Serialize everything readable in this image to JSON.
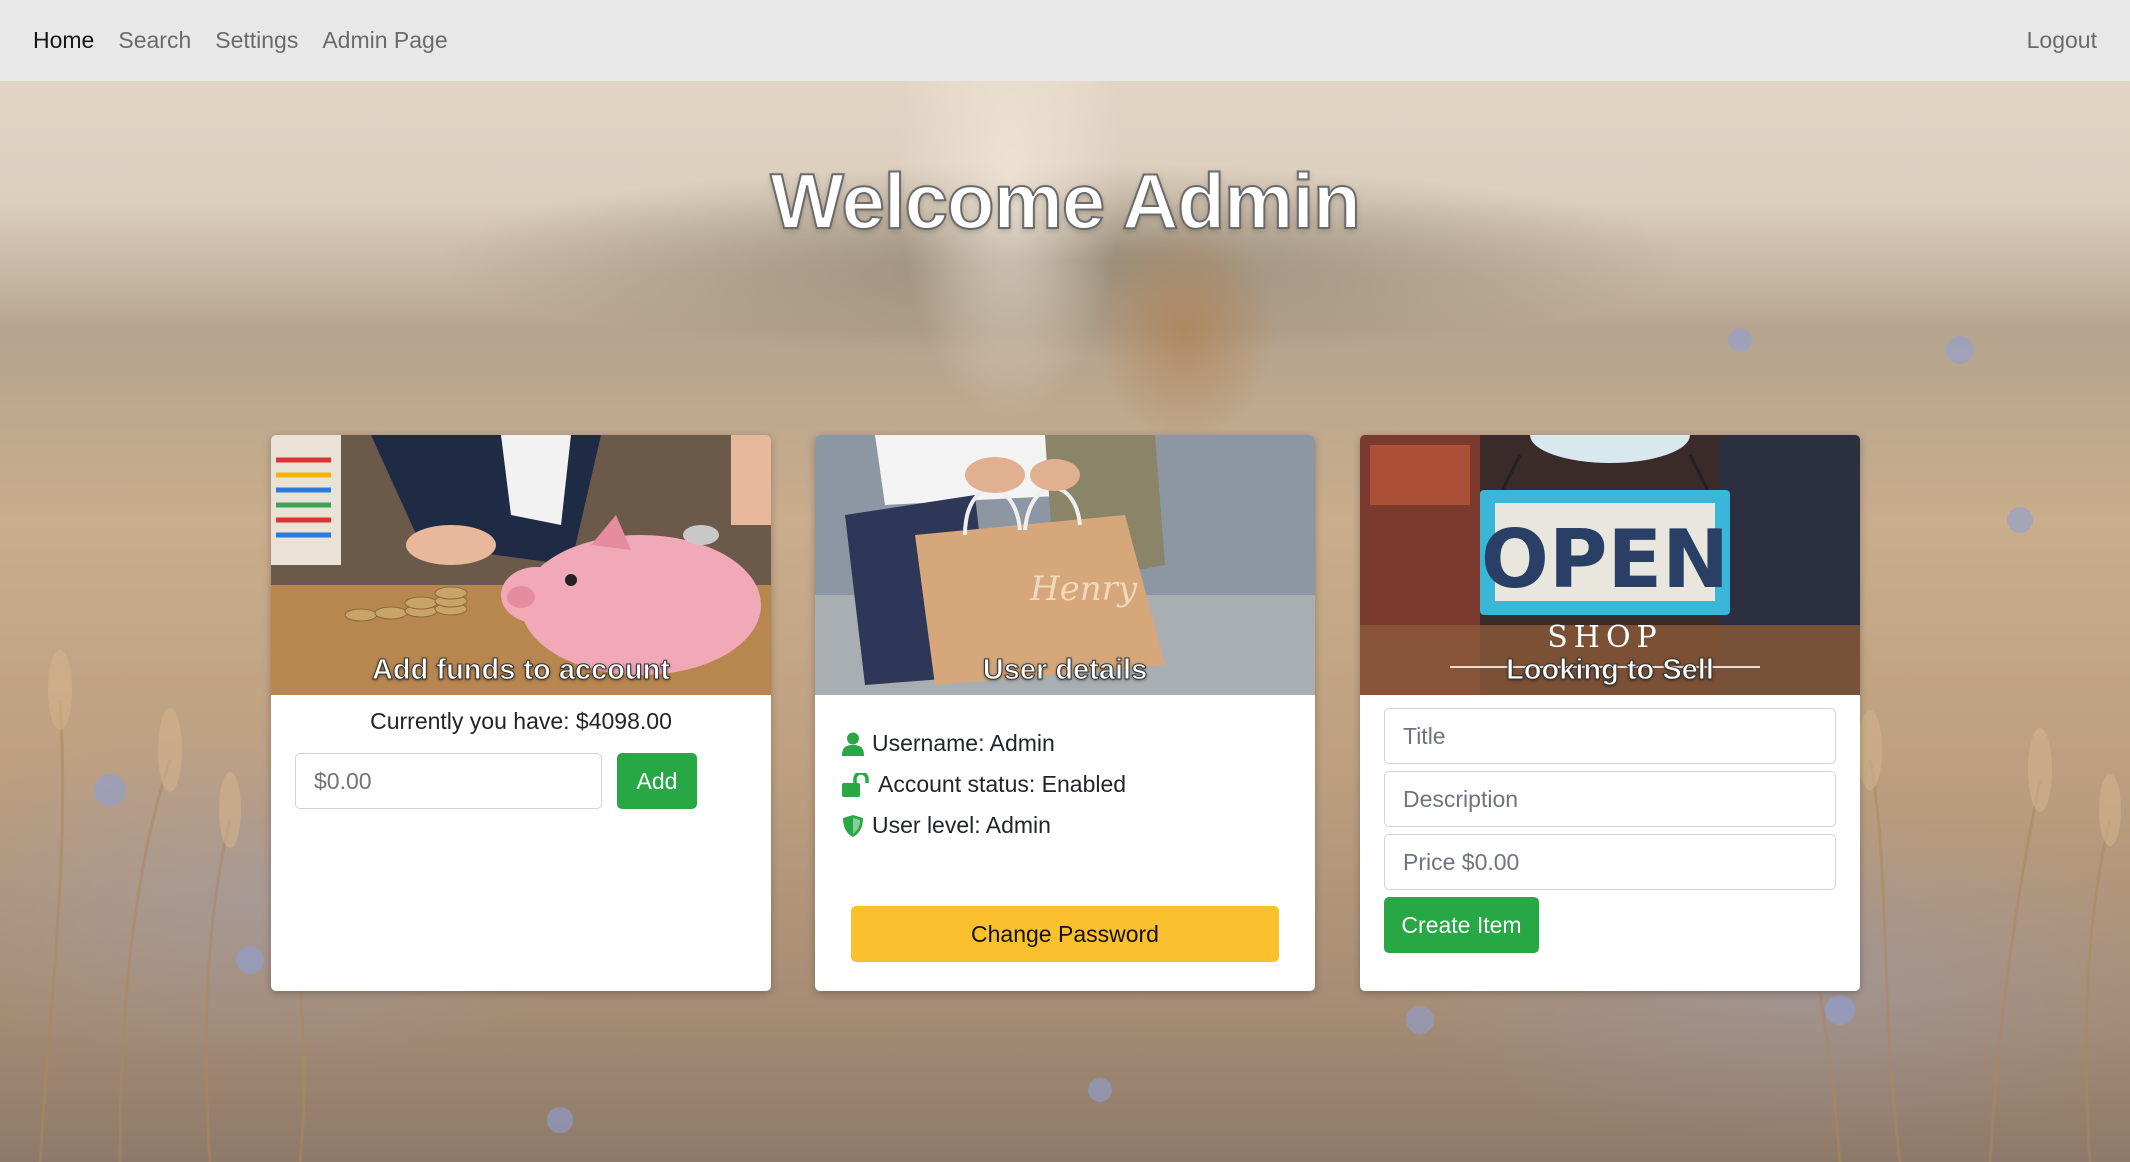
{
  "navbar": {
    "links": [
      "Home",
      "Search",
      "Settings",
      "Admin Page"
    ],
    "logout": "Logout"
  },
  "hero": {
    "title": "Welcome Admin"
  },
  "cards": {
    "funds": {
      "caption": "Add funds to account",
      "balance_text": "Currently you have: $4098.00",
      "amount_placeholder": "$0.00",
      "add_label": "Add"
    },
    "user": {
      "caption": "User details",
      "username": "Username: Admin",
      "status": "Account status: Enabled",
      "level": "User level: Admin",
      "change_password_label": "Change Password"
    },
    "sell": {
      "caption": "Looking to Sell",
      "sign_text": "OPEN",
      "sign_subtext": "SHOP",
      "title_placeholder": "Title",
      "description_placeholder": "Description",
      "price_placeholder": "Price $0.00",
      "create_label": "Create Item"
    }
  },
  "colors": {
    "navbar_bg": "#e8e8e8",
    "success": "#28a745",
    "warning": "#fbc02d"
  },
  "icons": {
    "username": "user-icon",
    "status": "unlock-icon",
    "level": "shield-icon"
  }
}
